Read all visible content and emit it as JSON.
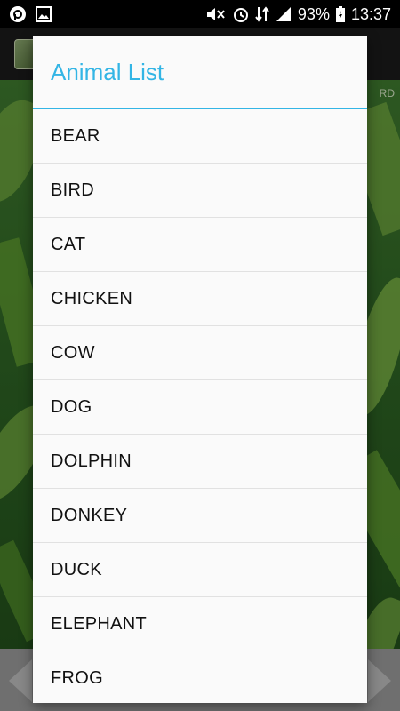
{
  "status_bar": {
    "battery_percent": "93%",
    "time": "13:37",
    "icons": [
      "app-notification-icon",
      "gallery-icon",
      "mute-icon",
      "alarm-icon",
      "data-transfer-icon",
      "signal-icon",
      "battery-charging-icon"
    ]
  },
  "background": {
    "label": "RD"
  },
  "dialog": {
    "title": "Animal List",
    "accent_color": "#33b5e5",
    "items": [
      "BEAR",
      "BIRD",
      "CAT",
      "CHICKEN",
      "COW",
      "DOG",
      "DOLPHIN",
      "DONKEY",
      "DUCK",
      "ELEPHANT",
      "FROG"
    ]
  }
}
